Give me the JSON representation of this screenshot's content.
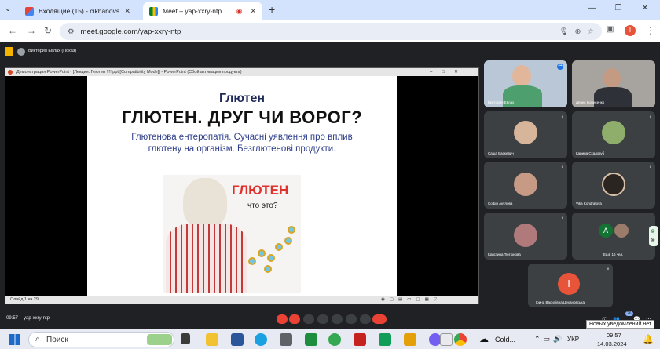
{
  "browser": {
    "tabs": [
      {
        "label": "Входящие (15) - cikhanovskaja..."
      },
      {
        "label": "Meet – yap-xxry-ntp"
      }
    ],
    "new_tab": "+",
    "url": "meet.google.com/yap-xxry-ntp",
    "profile_initial": "I"
  },
  "meet": {
    "presenter_label": "Виктория Евлах (Показ)",
    "meeting_time": "09:57",
    "meeting_code": "yap-xxry-ntp",
    "notification_badge": "26"
  },
  "ppt": {
    "window_title": "Демонстрация PowerPoint - [Лекция. Глютен !!!!.ppt [Compatibility Mode]] - PowerPoint (Сбой активации продукта)",
    "status_left": "Слайд 1 из 29",
    "slide": {
      "heading": "Глютен",
      "title": "ГЛЮТЕН. ДРУГ ЧИ ВОРОГ?",
      "subtitle_line1": "Глютенова ентеропатія. Сучасні уявлення про вплив",
      "subtitle_line2": "глютену на організм. Безглютенові продукти.",
      "image_word": "ГЛЮТЕН",
      "image_sub": "что это?"
    }
  },
  "participants": [
    {
      "name": "Виктория Евлах"
    },
    {
      "name": "Денис Борисенко"
    },
    {
      "name": "Саша Васкевич"
    },
    {
      "name": "Карина Скалозуб"
    },
    {
      "name": "Софія Акулова"
    },
    {
      "name": "Vika Kondratova"
    },
    {
      "name": "Кристина Тютюнова"
    },
    {
      "name": "Ещё 16 чел.",
      "avatar": "A"
    },
    {
      "name": "Ірина Василівна Цехановська",
      "avatar": "I"
    }
  ],
  "taskbar": {
    "search": "Поиск",
    "weather": "Cold...",
    "lang": "УКР",
    "time": "09:57",
    "date": "14.03.2024",
    "toast": "Новых уведомлений нет"
  },
  "colors": {
    "chrome_tabstrip": "#d3e3fd",
    "meet_bg": "#202124",
    "tile_bg": "#3c4043",
    "slide_title": "#1f2a5c",
    "slide_subtitle": "#2e3e8a",
    "glyten_red": "#e0312c",
    "end_call": "#ea4335"
  }
}
